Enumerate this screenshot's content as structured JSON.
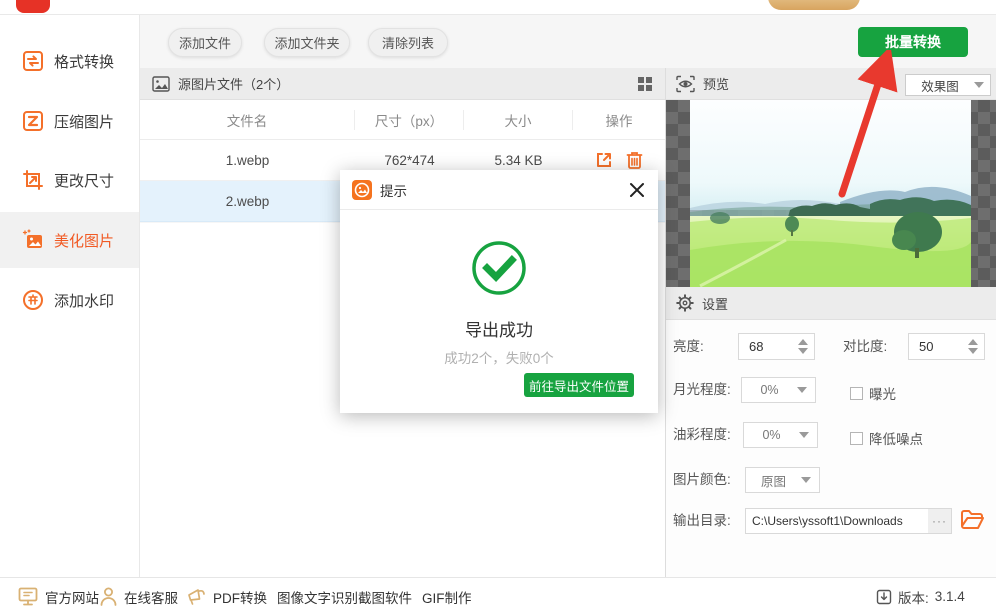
{
  "colors": {
    "accent_orange": "#f4702a",
    "active_orange": "#f15a24",
    "green": "#17a340",
    "arrow_red": "#e8392e",
    "tan": "#d9b173",
    "selected_row": "#e4f2fc"
  },
  "sidebar": {
    "items": [
      {
        "label": "格式转换",
        "icon": "format-convert-icon",
        "active": false
      },
      {
        "label": "压缩图片",
        "icon": "compress-image-icon",
        "active": false
      },
      {
        "label": "更改尺寸",
        "icon": "resize-icon",
        "active": false
      },
      {
        "label": "美化图片",
        "icon": "beautify-image-icon",
        "active": true
      },
      {
        "label": "添加水印",
        "icon": "watermark-icon",
        "active": false
      }
    ]
  },
  "toolbar": {
    "add_file": "添加文件",
    "add_folder": "添加文件夹",
    "clear_list": "清除列表",
    "batch_convert": "批量转换"
  },
  "file_panel": {
    "title": "源图片文件（2个）",
    "columns": [
      "文件名",
      "尺寸（px）",
      "大小",
      "操作"
    ],
    "rows": [
      {
        "name": "1.webp",
        "size_px": "762*474",
        "size": "5.34 KB"
      },
      {
        "name": "2.webp",
        "selected": true
      }
    ]
  },
  "preview": {
    "title": "预览",
    "mode": "效果图"
  },
  "settings": {
    "title": "设置",
    "brightness_label": "亮度:",
    "brightness": "68",
    "contrast_label": "对比度:",
    "contrast": "50",
    "moonlight_label": "月光程度:",
    "moonlight": "0%",
    "exposure_label": "曝光",
    "oilpaint_label": "油彩程度:",
    "oilpaint": "0%",
    "denoise_label": "降低噪点",
    "color_label": "图片颜色:",
    "color": "原图",
    "output_label": "输出目录:",
    "output_path": "C:\\Users\\yssoft1\\Downloads",
    "more": "···"
  },
  "dialog": {
    "title": "提示",
    "message": "导出成功",
    "detail": "成功2个，失败0个",
    "action": "前往导出文件位置"
  },
  "footer": {
    "links": [
      "官方网站",
      "在线客服",
      "PDF转换",
      "图像文字识别",
      "截图软件",
      "GIF制作"
    ],
    "version_label": "版本:",
    "version": "3.1.4"
  }
}
